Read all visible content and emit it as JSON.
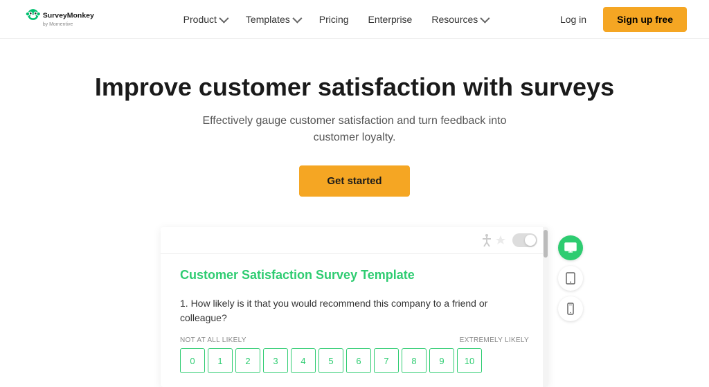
{
  "brand": {
    "name": "SurveyMonkey",
    "tagline": "by Momentive"
  },
  "nav": {
    "links": [
      {
        "label": "Product",
        "has_dropdown": true
      },
      {
        "label": "Templates",
        "has_dropdown": true
      },
      {
        "label": "Pricing",
        "has_dropdown": false
      },
      {
        "label": "Enterprise",
        "has_dropdown": false
      },
      {
        "label": "Resources",
        "has_dropdown": true
      }
    ],
    "login": "Log in",
    "signup": "Sign up free"
  },
  "hero": {
    "title": "Improve customer satisfaction with surveys",
    "subtitle": "Effectively gauge customer satisfaction and turn feedback into customer loyalty.",
    "cta": "Get started"
  },
  "preview": {
    "survey_title": "Customer Satisfaction Survey Template",
    "question": "1. How likely is it that you would recommend this company to a friend or colleague?",
    "rating_label_low": "NOT AT ALL LIKELY",
    "rating_label_high": "EXTREMELY LIKELY",
    "rating_boxes": [
      "0",
      "1",
      "2",
      "3",
      "4",
      "5",
      "6",
      "7",
      "8",
      "9",
      "10"
    ],
    "device_icons": [
      "desktop",
      "tablet",
      "mobile"
    ]
  }
}
